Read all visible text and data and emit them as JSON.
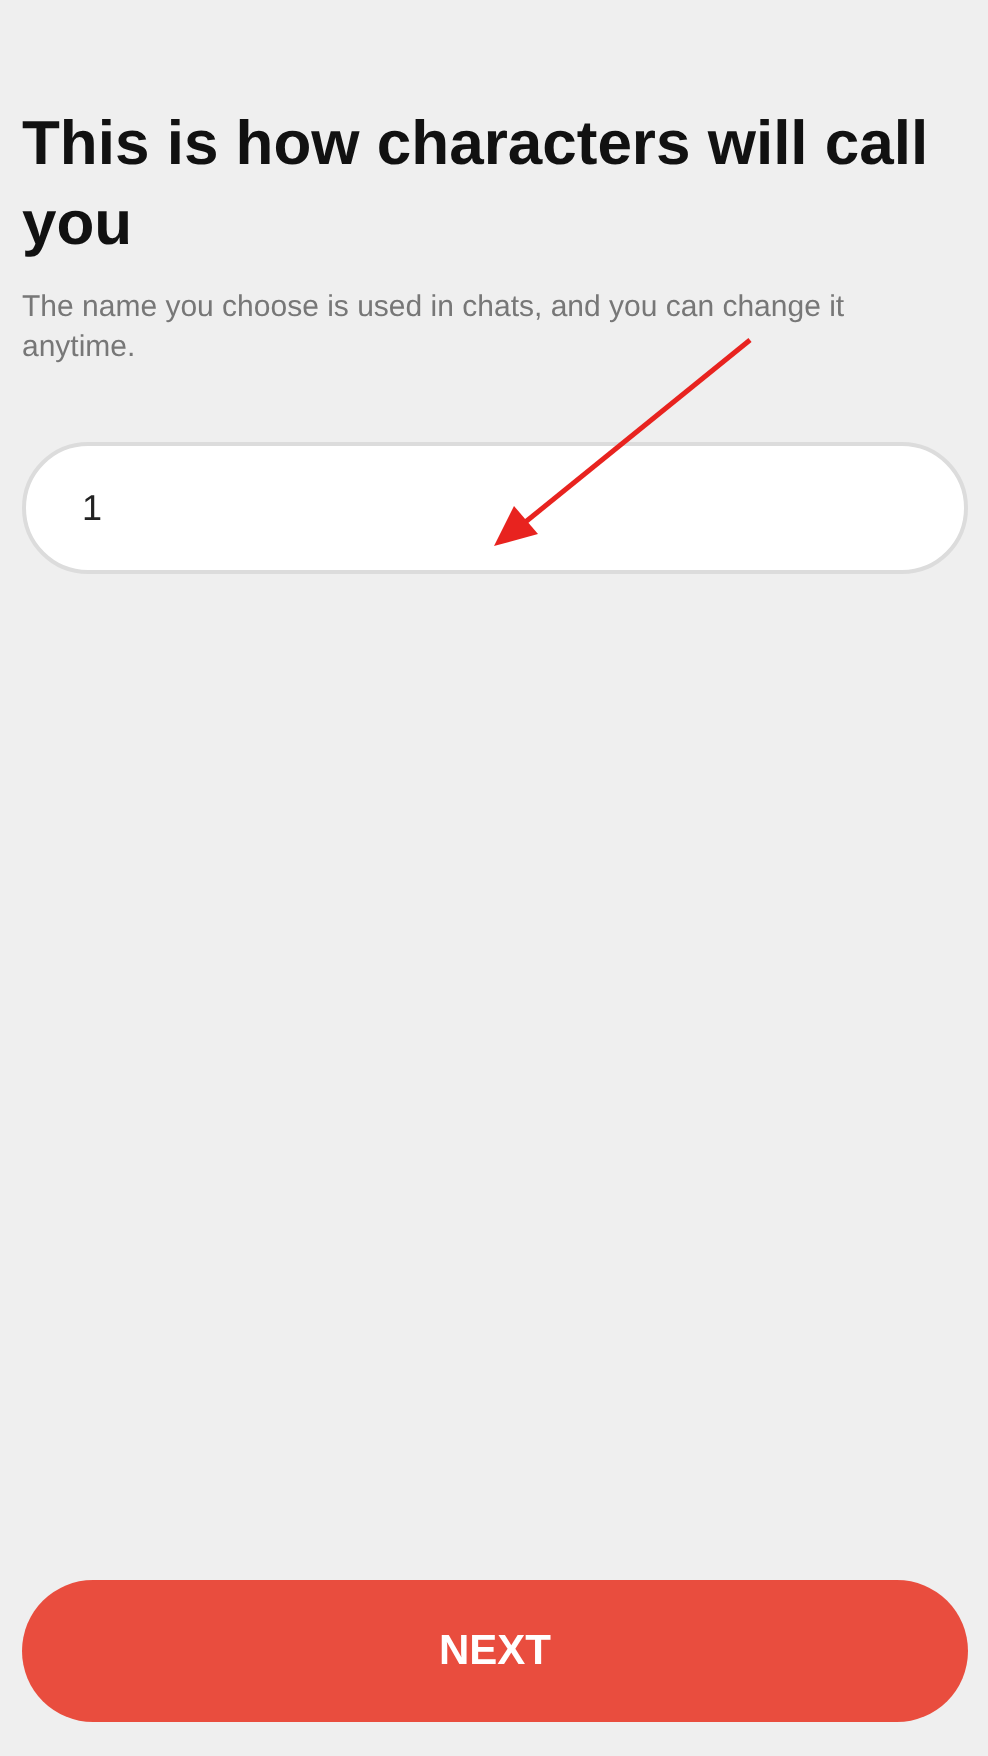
{
  "title": "This is how characters will call you",
  "subtitle": "The name you choose is used in chats, and you can change it anytime.",
  "name_field": {
    "value": "1"
  },
  "next_button": {
    "label": "NEXT"
  }
}
